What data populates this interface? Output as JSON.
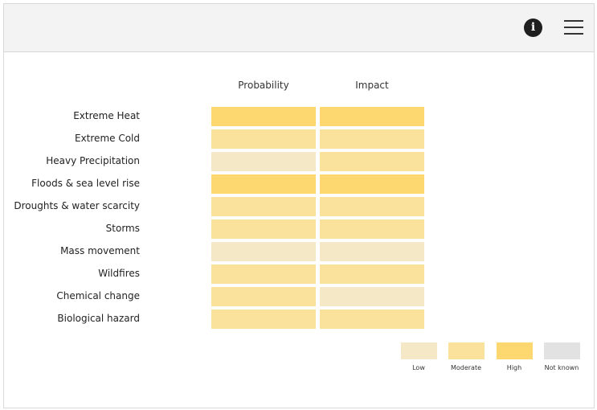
{
  "toolbar": {
    "info_icon": "info-icon",
    "menu_icon": "hamburger-menu-icon",
    "info_glyph": "i"
  },
  "chart_data": {
    "type": "heatmap",
    "columns": [
      "Probability",
      "Impact"
    ],
    "rows": [
      "Extreme Heat",
      "Extreme Cold",
      "Heavy Precipitation",
      "Floods & sea level rise",
      "Droughts & water scarcity",
      "Storms",
      "Mass movement",
      "Wildfires",
      "Chemical change",
      "Biological hazard"
    ],
    "values": [
      [
        "High",
        "High"
      ],
      [
        "Moderate",
        "Moderate"
      ],
      [
        "Low",
        "Moderate"
      ],
      [
        "High",
        "High"
      ],
      [
        "Moderate",
        "Moderate"
      ],
      [
        "Moderate",
        "Moderate"
      ],
      [
        "Low",
        "Low"
      ],
      [
        "Moderate",
        "Moderate"
      ],
      [
        "Moderate",
        "Low"
      ],
      [
        "Moderate",
        "Moderate"
      ]
    ],
    "legend": [
      {
        "label": "Low",
        "color": "#f5e8c6"
      },
      {
        "label": "Moderate",
        "color": "#fae29c"
      },
      {
        "label": "High",
        "color": "#fdd870"
      },
      {
        "label": "Not known",
        "color": "#e2e2e2"
      }
    ],
    "legend_placement": "bottom-right"
  }
}
